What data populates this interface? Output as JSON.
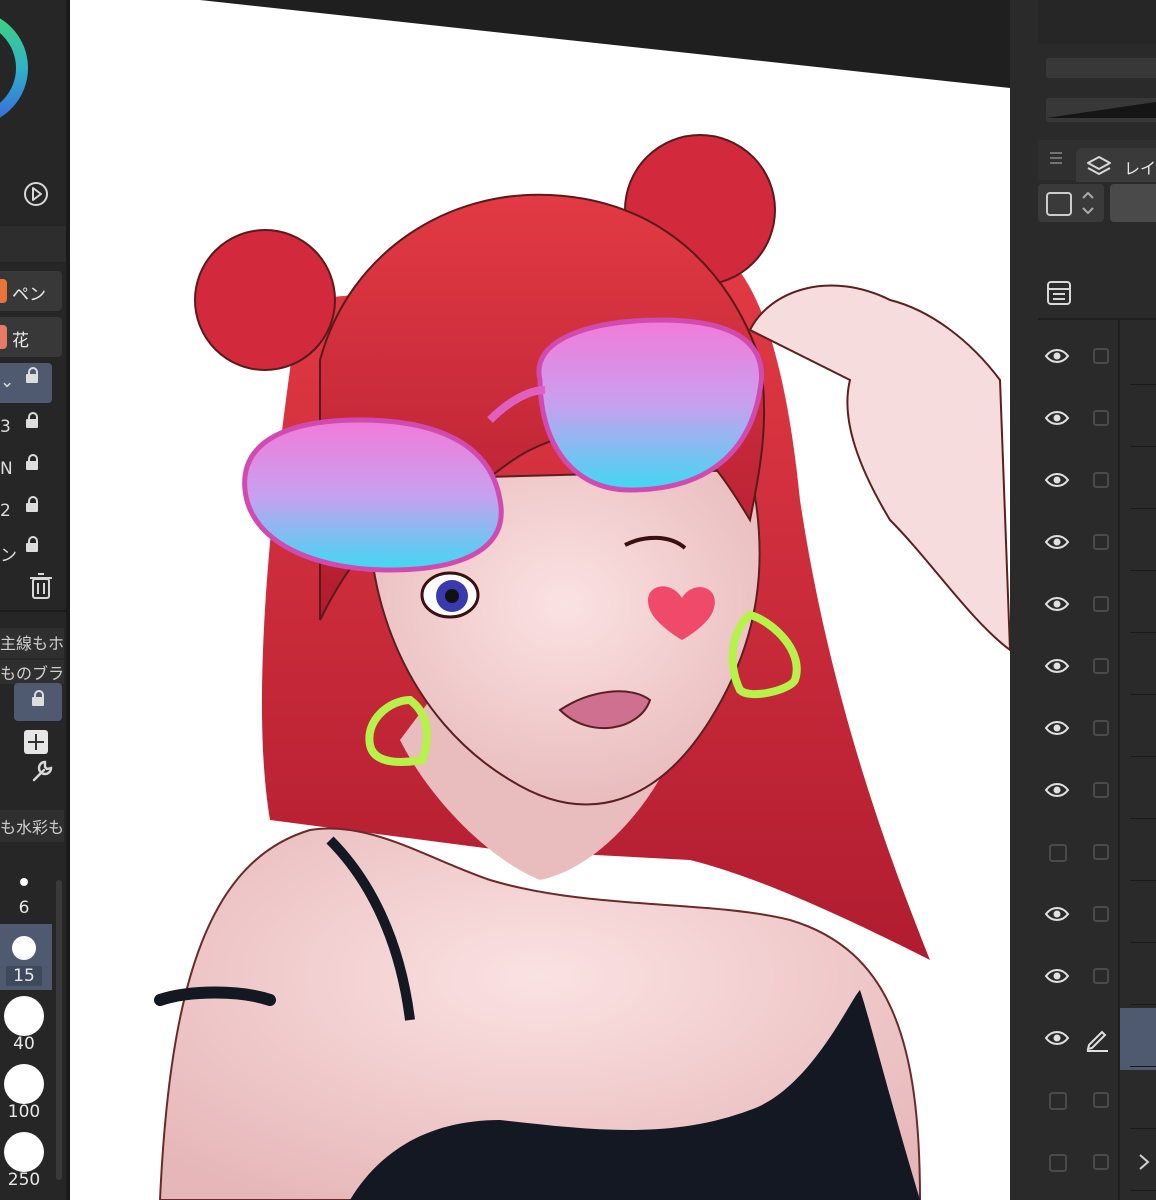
{
  "colors": {
    "canvas": "#ffffff",
    "panel": "#262626",
    "accent_selected": "#4f5a70",
    "hair": "#c9253a",
    "glasses_pink": "#f06ad0",
    "glasses_cyan": "#47d6f0",
    "earring_green": "#b6f24a",
    "heart_cheek": "#f04a6a"
  },
  "left_panel": {
    "sub_tools": [
      {
        "label": "ペン",
        "color": "#e8743a"
      },
      {
        "label": "花",
        "color": "#e87a66"
      }
    ],
    "layers": [
      {
        "label": "⌄"
      },
      {
        "label": "3"
      },
      {
        "label": "N"
      },
      {
        "label": "2"
      },
      {
        "label": "ン"
      }
    ],
    "properties": [
      {
        "label": "主線もホ"
      },
      {
        "label": "ものブラシ"
      }
    ],
    "preset_label": "も水彩も",
    "brush_sizes": [
      "6",
      "15",
      "40",
      "100",
      "250"
    ],
    "selected_size": "15"
  },
  "right_panel": {
    "tab_label": "レイ",
    "layer_count": 14
  }
}
